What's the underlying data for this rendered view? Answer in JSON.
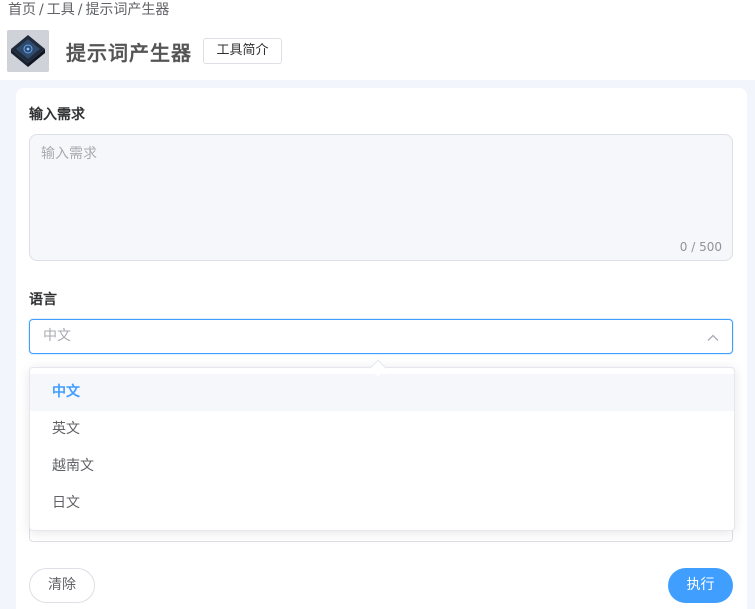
{
  "breadcrumb": {
    "items": [
      "首页",
      "工具",
      "提示词产生器"
    ],
    "separator": "/"
  },
  "header": {
    "title": "提示词产生器",
    "intro_button": "工具简介",
    "logo_icon": "chip-logo-icon"
  },
  "form": {
    "requirement": {
      "label": "输入需求",
      "placeholder": "输入需求",
      "value": "",
      "count": "0 / 500"
    },
    "language": {
      "label": "语言",
      "selected": "中文",
      "options": [
        "中文",
        "英文",
        "越南文",
        "日文"
      ]
    }
  },
  "actions": {
    "clear_label": "清除",
    "run_label": "执行"
  },
  "colors": {
    "accent": "#409eff",
    "page_bg": "#f2f6fc"
  }
}
